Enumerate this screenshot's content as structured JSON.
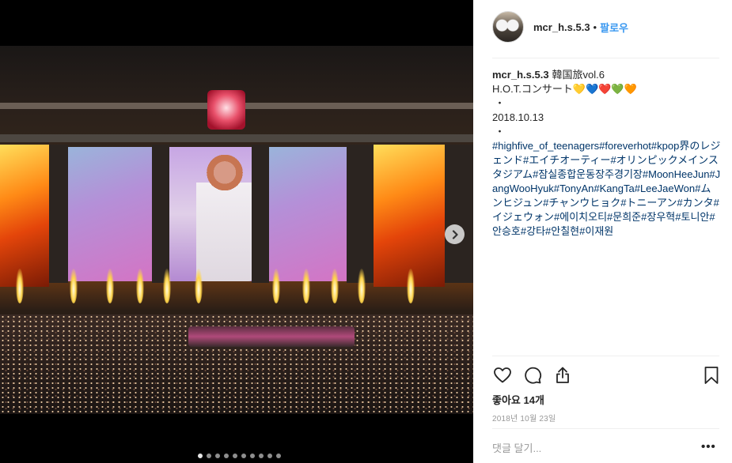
{
  "post": {
    "username": "mcr_h.s.5.3",
    "separator": "•",
    "follow_label": "팔로우",
    "caption_lines": [
      "韓国旅vol.6",
      "H.O.T.コンサート💛💙❤️💚🧡",
      "・",
      "2018.10.13",
      "・"
    ],
    "hashtags": "#highfive_of_teenagers#foreverhot#kpop界のレジェンド#エイチオーティー#オリンピックメインスタジアム#잠실종합운동장주경기장#MoonHeeJun#JangWooHyuk#TonyAn#KangTa#LeeJaeWon#ムンヒジュン#チャンウヒョク#トニーアン#カンタ#イジェウォン#에이치오티#문희준#장우혁#토니안#안승호#강타#안칠현#이재원",
    "likes": "좋아요 14개",
    "date": "2018년 10월 23일",
    "comment_placeholder": "댓글 달기...",
    "more_label": "•••"
  },
  "media": {
    "next_icon": "chevron-right-icon",
    "carousel_count": 10,
    "carousel_active": 0
  },
  "icons": {
    "like": "heart-icon",
    "comment": "comment-icon",
    "share": "share-icon",
    "save": "bookmark-icon"
  },
  "colors": {
    "link": "#3897f0",
    "hashtag": "#003569",
    "muted": "#999999"
  }
}
